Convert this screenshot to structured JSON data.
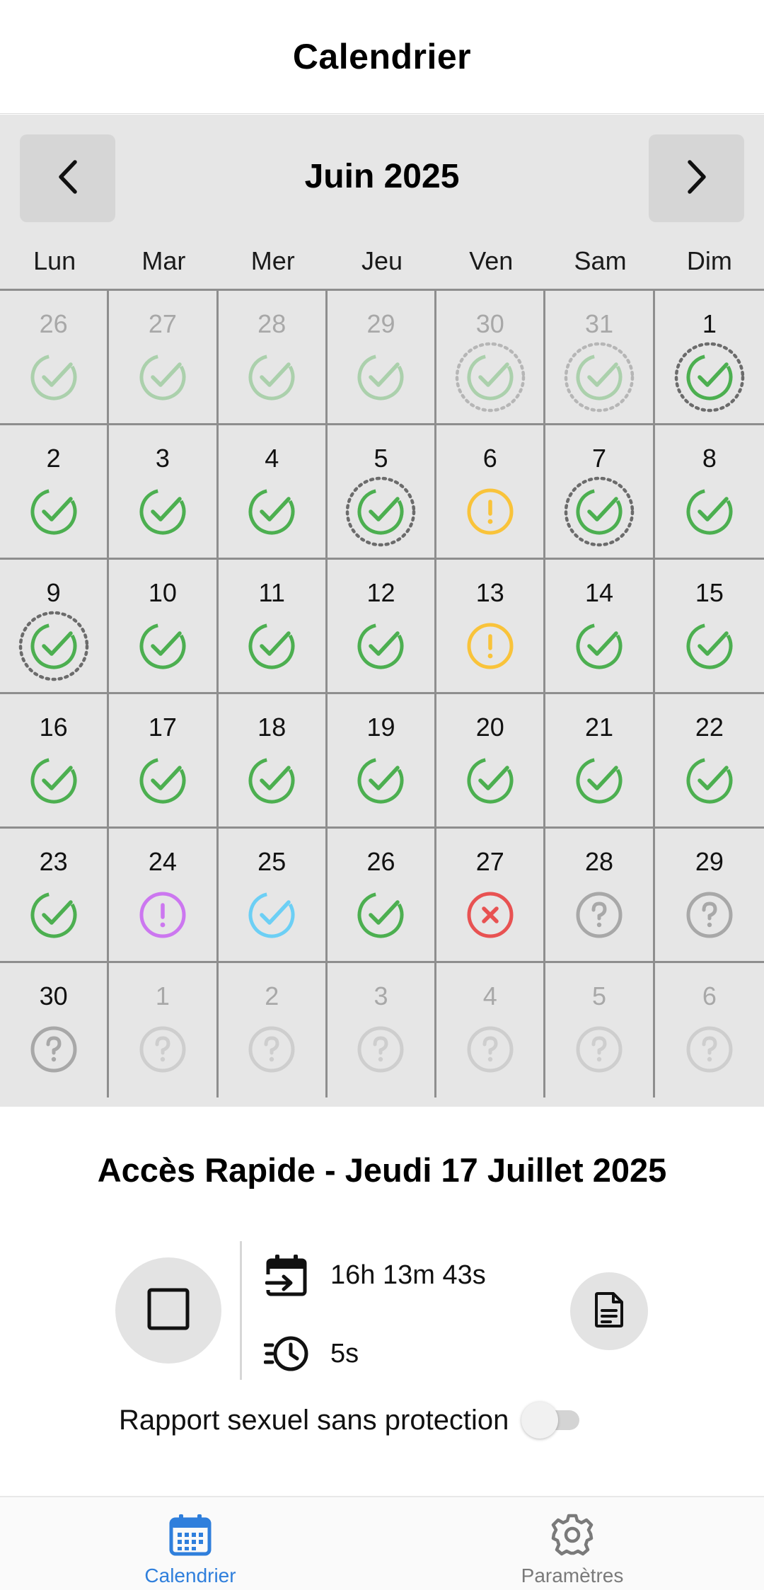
{
  "header": {
    "title": "Calendrier"
  },
  "calendar": {
    "month_label": "Juin 2025",
    "prev_icon": "chevron-left-icon",
    "next_icon": "chevron-right-icon",
    "weekdays": [
      "Lun",
      "Mar",
      "Mer",
      "Jeu",
      "Ven",
      "Sam",
      "Dim"
    ],
    "status_colors": {
      "taken": "#4caf50",
      "warning": "#f9c33a",
      "alert": "#cc77f0",
      "info": "#6ccff5",
      "missed": "#e85252",
      "unknown": "#a8a8a8",
      "highlight_ring": "#6b6b6b"
    },
    "days": [
      {
        "n": "26",
        "status": "taken",
        "faded": true,
        "ring": false
      },
      {
        "n": "27",
        "status": "taken",
        "faded": true,
        "ring": false
      },
      {
        "n": "28",
        "status": "taken",
        "faded": true,
        "ring": false
      },
      {
        "n": "29",
        "status": "taken",
        "faded": true,
        "ring": false
      },
      {
        "n": "30",
        "status": "taken",
        "faded": true,
        "ring": true
      },
      {
        "n": "31",
        "status": "taken",
        "faded": true,
        "ring": true
      },
      {
        "n": "1",
        "status": "taken",
        "faded": false,
        "ring": true
      },
      {
        "n": "2",
        "status": "taken",
        "faded": false,
        "ring": false
      },
      {
        "n": "3",
        "status": "taken",
        "faded": false,
        "ring": false
      },
      {
        "n": "4",
        "status": "taken",
        "faded": false,
        "ring": false
      },
      {
        "n": "5",
        "status": "taken",
        "faded": false,
        "ring": true
      },
      {
        "n": "6",
        "status": "warning",
        "faded": false,
        "ring": false
      },
      {
        "n": "7",
        "status": "taken",
        "faded": false,
        "ring": true
      },
      {
        "n": "8",
        "status": "taken",
        "faded": false,
        "ring": false
      },
      {
        "n": "9",
        "status": "taken",
        "faded": false,
        "ring": true
      },
      {
        "n": "10",
        "status": "taken",
        "faded": false,
        "ring": false
      },
      {
        "n": "11",
        "status": "taken",
        "faded": false,
        "ring": false
      },
      {
        "n": "12",
        "status": "taken",
        "faded": false,
        "ring": false
      },
      {
        "n": "13",
        "status": "warning",
        "faded": false,
        "ring": false
      },
      {
        "n": "14",
        "status": "taken",
        "faded": false,
        "ring": false
      },
      {
        "n": "15",
        "status": "taken",
        "faded": false,
        "ring": false
      },
      {
        "n": "16",
        "status": "taken",
        "faded": false,
        "ring": false
      },
      {
        "n": "17",
        "status": "taken",
        "faded": false,
        "ring": false
      },
      {
        "n": "18",
        "status": "taken",
        "faded": false,
        "ring": false
      },
      {
        "n": "19",
        "status": "taken",
        "faded": false,
        "ring": false
      },
      {
        "n": "20",
        "status": "taken",
        "faded": false,
        "ring": false
      },
      {
        "n": "21",
        "status": "taken",
        "faded": false,
        "ring": false
      },
      {
        "n": "22",
        "status": "taken",
        "faded": false,
        "ring": false
      },
      {
        "n": "23",
        "status": "taken",
        "faded": false,
        "ring": false
      },
      {
        "n": "24",
        "status": "alert",
        "faded": false,
        "ring": false
      },
      {
        "n": "25",
        "status": "info",
        "faded": false,
        "ring": false
      },
      {
        "n": "26",
        "status": "taken",
        "faded": false,
        "ring": false
      },
      {
        "n": "27",
        "status": "missed",
        "faded": false,
        "ring": false
      },
      {
        "n": "28",
        "status": "unknown",
        "faded": false,
        "ring": false
      },
      {
        "n": "29",
        "status": "unknown",
        "faded": false,
        "ring": false
      },
      {
        "n": "30",
        "status": "unknown",
        "faded": false,
        "ring": false
      },
      {
        "n": "1",
        "status": "unknown",
        "faded": true,
        "ring": false
      },
      {
        "n": "2",
        "status": "unknown",
        "faded": true,
        "ring": false
      },
      {
        "n": "3",
        "status": "unknown",
        "faded": true,
        "ring": false
      },
      {
        "n": "4",
        "status": "unknown",
        "faded": true,
        "ring": false
      },
      {
        "n": "5",
        "status": "unknown",
        "faded": true,
        "ring": false
      },
      {
        "n": "6",
        "status": "unknown",
        "faded": true,
        "ring": false
      }
    ]
  },
  "quick_access": {
    "title": "Accès Rapide - Jeudi 17 Juillet 2025",
    "stop_icon": "stop-square-icon",
    "elapsed_icon": "calendar-arrow-icon",
    "elapsed": "16h 13m 43s",
    "duration_icon": "fast-clock-icon",
    "duration": "5s",
    "document_icon": "document-icon",
    "toggle_label": "Rapport sexuel sans protection",
    "toggle_on": false
  },
  "tabbar": {
    "accent": "#2f7fdc",
    "tabs": [
      {
        "label": "Calendrier",
        "icon": "calendar-grid-icon",
        "active": true
      },
      {
        "label": "Paramètres",
        "icon": "gear-icon",
        "active": false
      }
    ]
  }
}
